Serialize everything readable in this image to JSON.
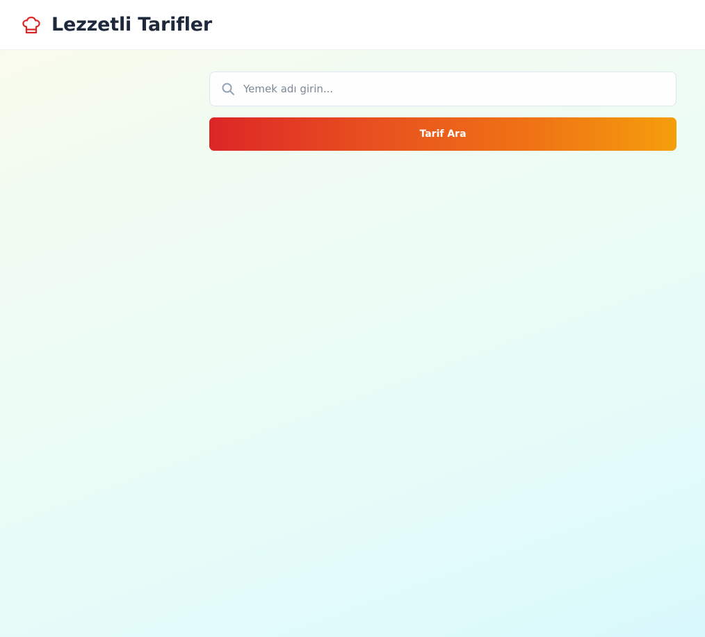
{
  "header": {
    "logo_icon": "chef-hat-icon",
    "title": "Lezzetli Tarifler"
  },
  "search": {
    "icon": "search-icon",
    "value": "",
    "placeholder": "Yemek adı girin...",
    "button_label": "Tarif Ara"
  },
  "colors": {
    "brand_red": "#dc2626",
    "brand_orange": "#f59e0b",
    "title_text": "#1e293b"
  }
}
